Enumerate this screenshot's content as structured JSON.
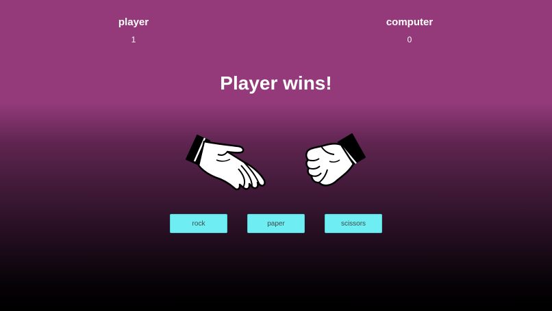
{
  "scoreboard": {
    "player": {
      "label": "player",
      "score": "1"
    },
    "computer": {
      "label": "computer",
      "score": "0"
    }
  },
  "result_text": "Player wins!",
  "hands": {
    "player_choice_icon": "paper-hand-icon",
    "computer_choice_icon": "rock-fist-icon"
  },
  "choices": {
    "rock": "rock",
    "paper": "paper",
    "scissors": "scissors"
  },
  "colors": {
    "background_top": "#943a7b",
    "background_bottom": "#000000",
    "button_fill": "#6eeef2",
    "text": "#ffffff"
  }
}
